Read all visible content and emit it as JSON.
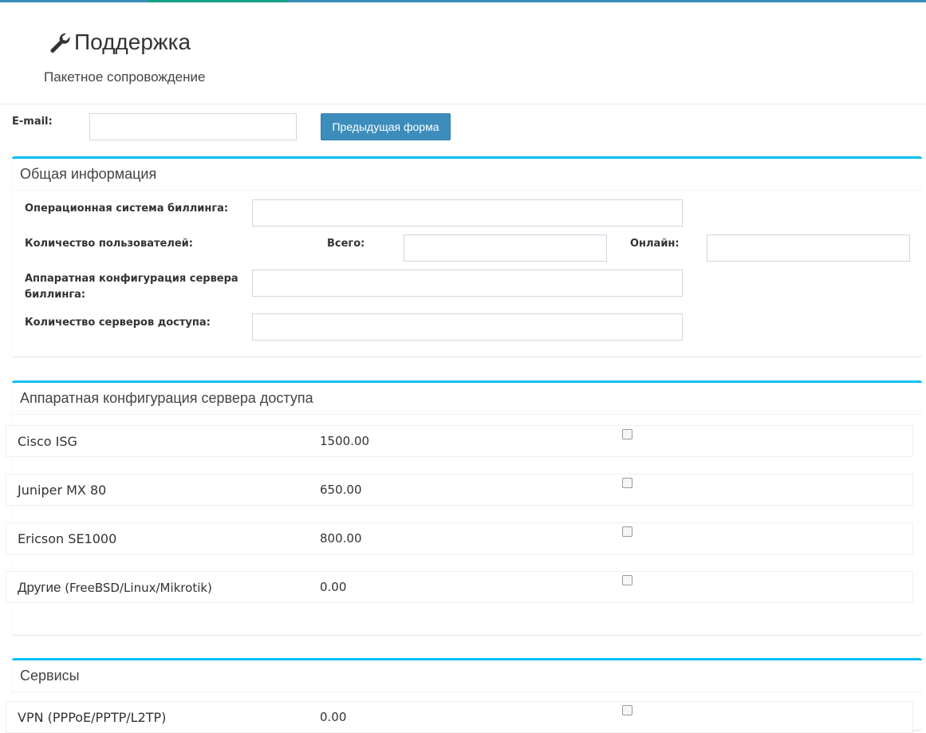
{
  "header": {
    "title": "Поддержка",
    "subtitle": "Пакетное сопровождение",
    "title_icon": "wrench-icon"
  },
  "email": {
    "label": "E-mail:",
    "value": "",
    "prev_button": "Предыдущая форма"
  },
  "general": {
    "title": "Общая информация",
    "billing_os_label": "Операционная система биллинга:",
    "users_label": "Количество пользователей:",
    "total_label": "Всего:",
    "online_label": "Онлайн:",
    "billing_hw_label_line1": "Аппаратная конфигурация сервера",
    "billing_hw_label_line2": "биллинга:",
    "access_servers_label": "Количество серверов доступа:"
  },
  "access_hw": {
    "title": "Аппаратная конфигурация сервера доступа",
    "items": [
      {
        "name": "Cisco ISG",
        "extra": "",
        "price": "1500.00",
        "checked": false
      },
      {
        "name": "Juniper MX 80",
        "extra": "",
        "price": "650.00",
        "checked": false
      },
      {
        "name": "Ericson SE1000",
        "extra": "",
        "price": "800.00",
        "checked": false
      },
      {
        "name": "Другие",
        "extra": " (FreeBSD/Linux/Mikrotik)",
        "price": "0.00",
        "checked": false
      }
    ]
  },
  "services": {
    "title": "Сервисы",
    "items": [
      {
        "name": "VPN (PPPoE/PPTP/L2TP)",
        "price": "0.00",
        "checked": false
      }
    ]
  },
  "colors": {
    "accent": "#3c8dbc",
    "box_border": "#00c0ef",
    "active_tab": "#16a086"
  }
}
